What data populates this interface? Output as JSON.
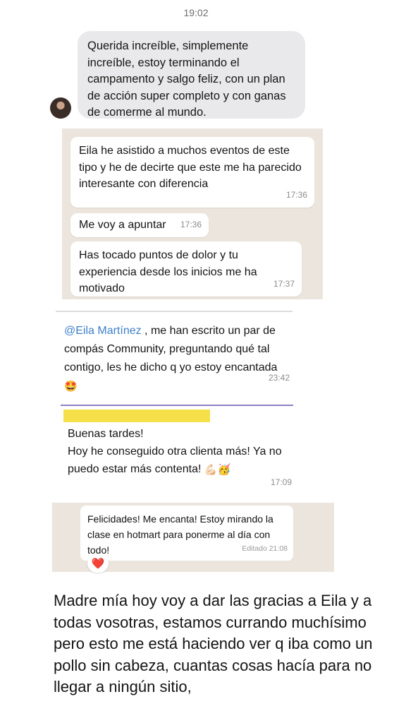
{
  "top_time": "19:02",
  "imessage": {
    "text": "Querida increíble, simplemente increíble, estoy terminando el campamento y salgo feliz, con un plan de acción super completo y con ganas de comerme al mundo."
  },
  "chat1": {
    "messages": [
      {
        "text": "Eila he asistido a muchos eventos de este tipo y he de decirte que este me ha parecido interesante con diferencia",
        "time": "17:36"
      },
      {
        "text": "Me voy a apuntar",
        "time": "17:36"
      },
      {
        "text": "Has tocado puntos de dolor y tu experiencia desde los inicios me ha motivado",
        "time": "17:37"
      }
    ]
  },
  "chat2": {
    "mention": "@Eila Martínez",
    "text": " , me han escrito un par de compás Community, preguntando qué tal contigo, les he dicho q yo estoy encantada",
    "emoji": "🤩",
    "time": "23:42"
  },
  "chat3": {
    "line1": "Buenas tardes!",
    "line2": "Hoy he conseguido otra clienta más! Ya no puedo estar más contenta!",
    "emoji": "💪🏻🥳",
    "time": "17:09"
  },
  "chat4": {
    "text": "Felicidades! Me encanta! Estoy mirando la clase en hotmart para ponerme al día con todo!",
    "edited": "Editado 21:08",
    "reaction": "❤️"
  },
  "caption": "Madre mía hoy voy a dar las gracias a Eila y a todas vosotras, estamos currando muchísimo pero esto me está haciendo ver q iba como un pollo sin cabeza, cuantas cosas hacía para no llegar a ningún sitio,"
}
